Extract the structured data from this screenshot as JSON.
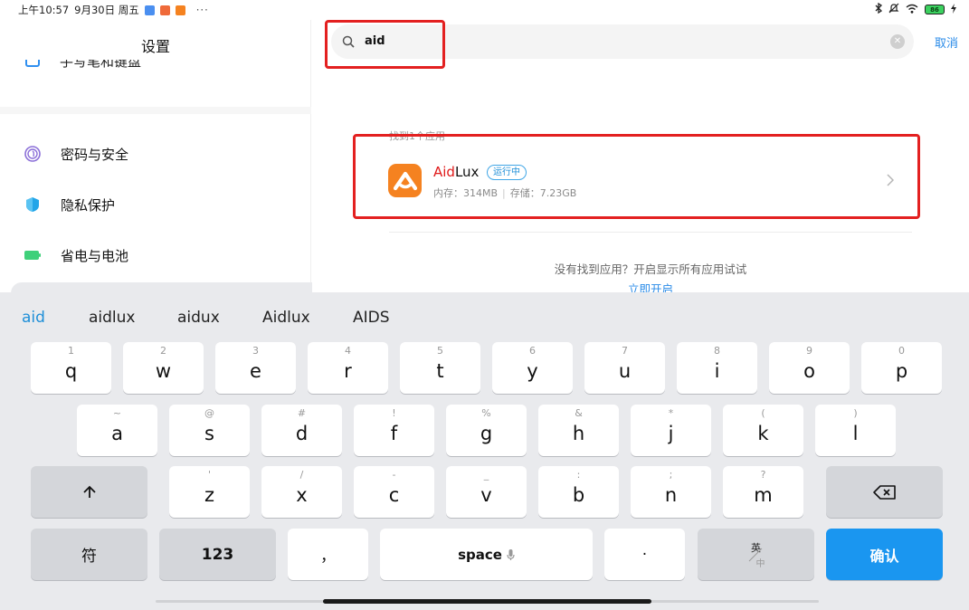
{
  "status_bar": {
    "time": "上午10:57",
    "date": "9月30日 周五",
    "more": "···",
    "battery": "86"
  },
  "left_panel": {
    "title": "设置",
    "partial_item": "手写笔和键盘",
    "items": [
      {
        "label": "密码与安全",
        "icon": "fingerprint-icon"
      },
      {
        "label": "隐私保护",
        "icon": "shield-icon"
      },
      {
        "label": "省电与电池",
        "icon": "battery-icon"
      }
    ]
  },
  "search": {
    "value": "aid",
    "cancel_label": "取消"
  },
  "results": {
    "header": "找到1个应用",
    "app": {
      "name_match": "Aid",
      "name_rest": "Lux",
      "badge": "运行中",
      "memory": "内存：314MB",
      "storage": "存储：7.23GB"
    },
    "not_found_text": "没有找到应用？开启显示所有应用试试",
    "open_link": "立即开启"
  },
  "keyboard": {
    "suggestions": [
      "aid",
      "aidlux",
      "aidux",
      "Aidlux",
      "AIDS"
    ],
    "row1": [
      {
        "main": "q",
        "sub": "1"
      },
      {
        "main": "w",
        "sub": "2"
      },
      {
        "main": "e",
        "sub": "3"
      },
      {
        "main": "r",
        "sub": "4"
      },
      {
        "main": "t",
        "sub": "5"
      },
      {
        "main": "y",
        "sub": "6"
      },
      {
        "main": "u",
        "sub": "7"
      },
      {
        "main": "i",
        "sub": "8"
      },
      {
        "main": "o",
        "sub": "9"
      },
      {
        "main": "p",
        "sub": "0"
      }
    ],
    "row2": [
      {
        "main": "a",
        "sub": "~"
      },
      {
        "main": "s",
        "sub": "@"
      },
      {
        "main": "d",
        "sub": "#"
      },
      {
        "main": "f",
        "sub": "!"
      },
      {
        "main": "g",
        "sub": "%"
      },
      {
        "main": "h",
        "sub": "&"
      },
      {
        "main": "j",
        "sub": "*"
      },
      {
        "main": "k",
        "sub": "("
      },
      {
        "main": "l",
        "sub": ")"
      }
    ],
    "row3": [
      {
        "main": "z",
        "sub": "'"
      },
      {
        "main": "x",
        "sub": "/"
      },
      {
        "main": "c",
        "sub": "-"
      },
      {
        "main": "v",
        "sub": "_"
      },
      {
        "main": "b",
        "sub": ":"
      },
      {
        "main": "n",
        "sub": ";"
      },
      {
        "main": "m",
        "sub": "?"
      }
    ],
    "symbol_key": "符",
    "number_key": "123",
    "comma_key": "，",
    "space_key": "space",
    "period_key": "·",
    "lang_top": "英",
    "lang_bottom": "中",
    "confirm_key": "确认"
  },
  "colors": {
    "accent": "#1a96f0",
    "highlight_red": "#e01919",
    "annotation_red": "#e32020",
    "app_icon_orange": "#f58220"
  }
}
